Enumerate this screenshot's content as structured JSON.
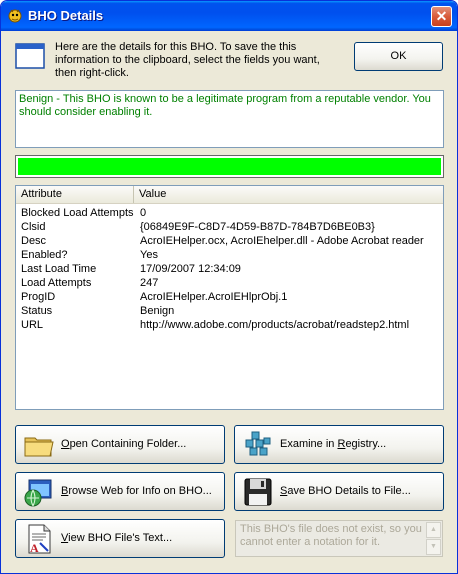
{
  "window": {
    "title": "BHO Details",
    "close_glyph": "✕"
  },
  "intro": {
    "text": "Here are the details for this BHO.  To save the this information to the clipboard, select the fields you want, then right-click."
  },
  "ok_button": {
    "label": "OK"
  },
  "verdict": {
    "text": "Benign - This BHO is known to be a legitimate program from a reputable vendor.  You should consider enabling it.",
    "color": "#008000"
  },
  "progress": {
    "fraction": 1.0,
    "color": "#00ff00"
  },
  "details": {
    "columns": [
      "Attribute",
      "Value"
    ],
    "rows": [
      {
        "attribute": "Blocked Load Attempts",
        "value": "0"
      },
      {
        "attribute": "Clsid",
        "value": "{06849E9F-C8D7-4D59-B87D-784B7D6BE0B3}"
      },
      {
        "attribute": "Desc",
        "value": "AcroIEHelper.ocx, AcroIEhelper.dll - Adobe Acrobat reader"
      },
      {
        "attribute": "Enabled?",
        "value": "Yes"
      },
      {
        "attribute": "Last Load Time",
        "value": "17/09/2007 12:34:09"
      },
      {
        "attribute": "Load Attempts",
        "value": "247"
      },
      {
        "attribute": "ProgID",
        "value": "AcroIEHelper.AcroIEHlprObj.1"
      },
      {
        "attribute": "Status",
        "value": "Benign"
      },
      {
        "attribute": "URL",
        "value": "http://www.adobe.com/products/acrobat/readstep2.html"
      }
    ]
  },
  "buttons": {
    "open_folder": {
      "u": "O",
      "rest": "pen Containing Folder...",
      "icon": "folder-icon"
    },
    "examine_registry": {
      "pre": "Examine in ",
      "u": "R",
      "rest": "egistry...",
      "icon": "registry-icon"
    },
    "browse_web": {
      "u": "B",
      "rest": "rowse Web for Info on BHO...",
      "icon": "web-browser-icon"
    },
    "save_details": {
      "u": "S",
      "rest": "ave BHO Details to File...",
      "icon": "floppy-disk-icon"
    },
    "view_text": {
      "u": "V",
      "rest": "iew BHO File's Text...",
      "icon": "text-document-icon"
    }
  },
  "notation": {
    "text": "This BHO's file does not exist, so you cannot enter a notation for it."
  }
}
